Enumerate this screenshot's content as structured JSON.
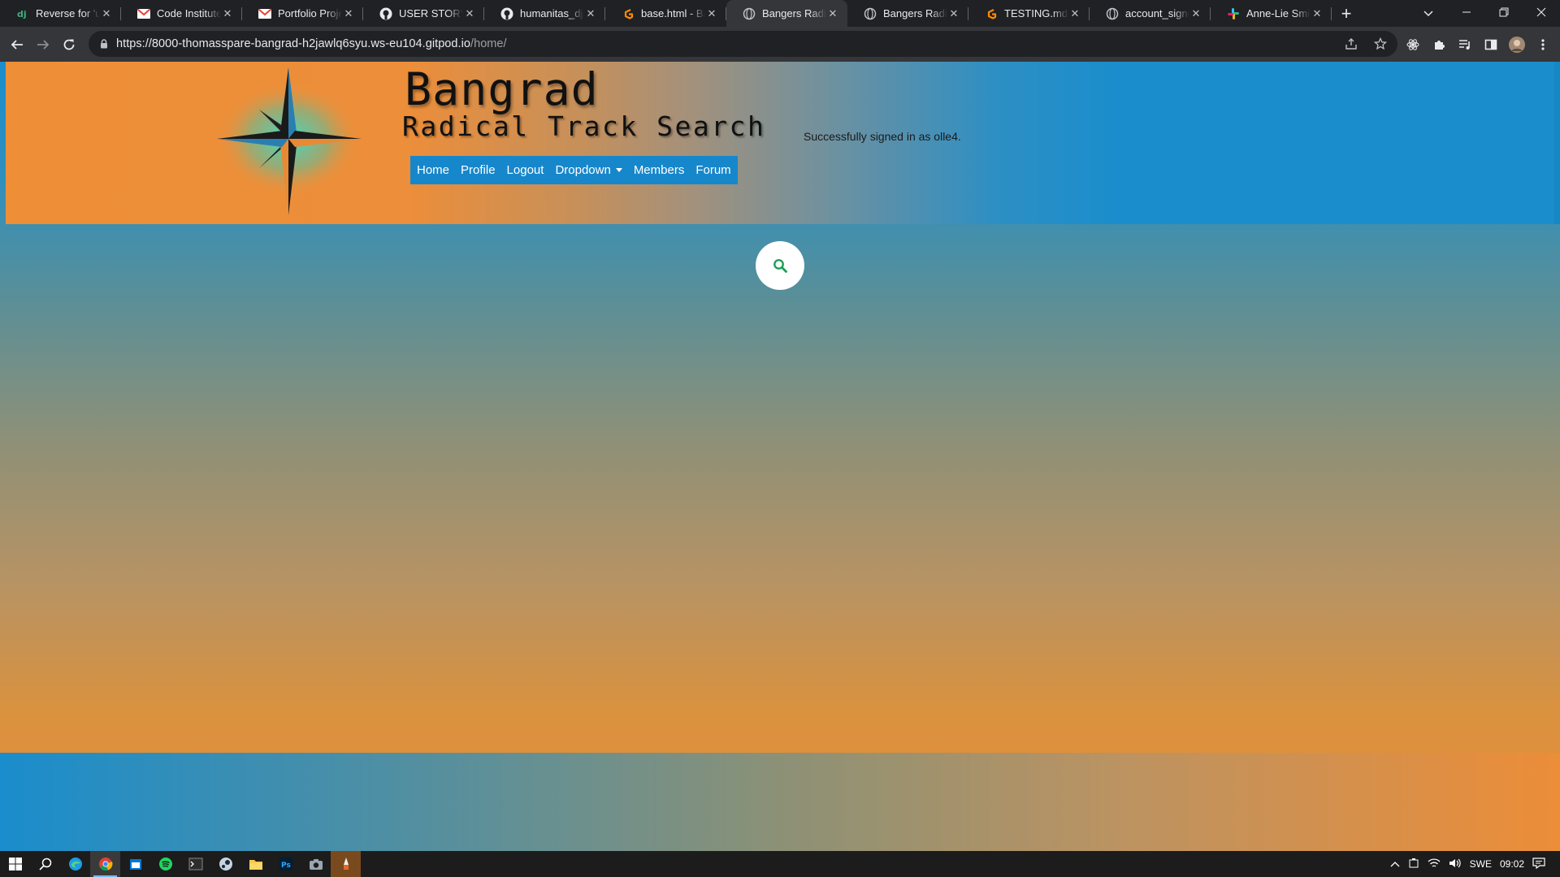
{
  "browser": {
    "tabs": [
      {
        "title": "Reverse for 'upd",
        "icon": "django-favicon",
        "active": false
      },
      {
        "title": "Code Institute -",
        "icon": "gmail-favicon",
        "active": false
      },
      {
        "title": "Portfolio Project",
        "icon": "gmail-favicon",
        "active": false
      },
      {
        "title": "USER STORY: <",
        "icon": "github-favicon",
        "active": false
      },
      {
        "title": "humanitas_djan",
        "icon": "github-favicon",
        "active": false
      },
      {
        "title": "base.html - Ban",
        "icon": "gitpod-favicon",
        "active": false
      },
      {
        "title": "Bangers Radical",
        "icon": "globe-favicon",
        "active": true
      },
      {
        "title": "Bangers Radical",
        "icon": "globe-favicon",
        "active": false
      },
      {
        "title": "TESTING.md - B",
        "icon": "gitpod-favicon",
        "active": false
      },
      {
        "title": "account_signup",
        "icon": "globe-favicon",
        "active": false
      },
      {
        "title": "Anne-Lie Smith",
        "icon": "slack-favicon",
        "active": false
      }
    ],
    "url_host": "https://8000-thomasspare-bangrad-h2jawlq6syu.ws-eu104.gitpod.io",
    "url_path": "/home/"
  },
  "site": {
    "title": "Bangrad",
    "subtitle": "Radical Track Search",
    "nav": {
      "home": "Home",
      "profile": "Profile",
      "logout": "Logout",
      "dropdown": "Dropdown",
      "members": "Members",
      "forum": "Forum"
    },
    "signed_in_message": "Successfully signed in as olle4.",
    "colors": {
      "orange": "#ee8f37",
      "blue": "#1a8dcc",
      "nav_bg": "#1787cb",
      "search_icon": "#18a058"
    }
  },
  "taskbar": {
    "language": "SWE",
    "time": "09:02"
  }
}
